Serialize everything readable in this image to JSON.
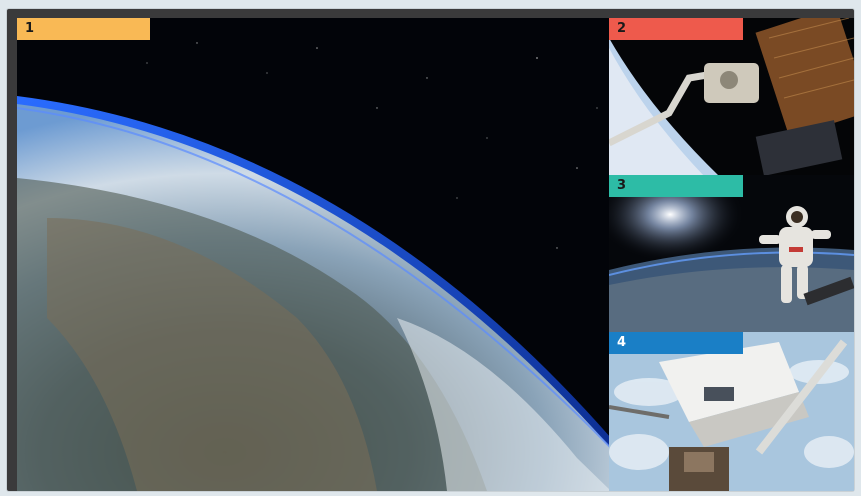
{
  "panes": [
    {
      "number": "1",
      "label_color": "#f9b955",
      "scene": "earth-from-orbit"
    },
    {
      "number": "2",
      "label_color": "#ee5a4c",
      "scene": "robotic-arm-spacewalk"
    },
    {
      "number": "3",
      "label_color": "#2dbca6",
      "scene": "floating-astronaut"
    },
    {
      "number": "4",
      "label_color": "#1a7fc6",
      "scene": "shuttle-docking"
    }
  ]
}
